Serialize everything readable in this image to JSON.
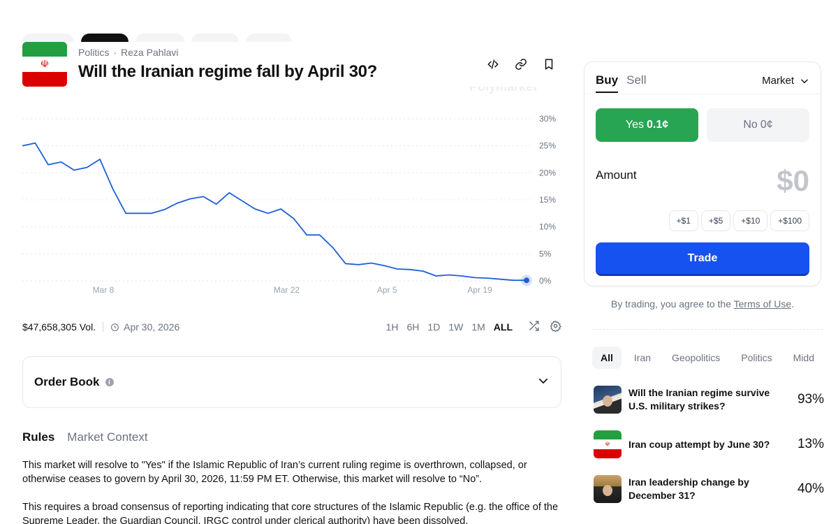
{
  "header": {
    "category": "Politics",
    "subcategory": "Reza Pahlavi",
    "title": "Will the Iranian regime fall by April 30?",
    "watermark": "Polymarket"
  },
  "chart_data": {
    "type": "line",
    "x": [
      "Mar 3",
      "Mar 4",
      "Mar 5",
      "Mar 6",
      "Mar 7",
      "Mar 8",
      "Mar 9",
      "Mar 10",
      "Mar 11",
      "Mar 12",
      "Mar 13",
      "Mar 14",
      "Mar 15",
      "Mar 16",
      "Mar 17",
      "Mar 18",
      "Mar 19",
      "Mar 20",
      "Mar 21",
      "Mar 22",
      "Mar 23",
      "Mar 24",
      "Mar 26",
      "Mar 28",
      "Mar 30",
      "Apr 1",
      "Apr 3",
      "Apr 5",
      "Apr 7",
      "Apr 9",
      "Apr 11",
      "Apr 13",
      "Apr 15",
      "Apr 17",
      "Apr 19",
      "Apr 21",
      "Apr 23",
      "Apr 25",
      "Apr 27",
      "Apr 29"
    ],
    "series": [
      {
        "values": [
          25,
          25.5,
          21.5,
          22,
          20.5,
          21,
          22.5,
          17,
          12.5,
          12.5,
          12.5,
          13.2,
          14.4,
          15.2,
          15.6,
          14.2,
          16.3,
          14.8,
          13.3,
          12.5,
          13.3,
          11.5,
          8.5,
          8.5,
          6.2,
          3.2,
          3,
          3.3,
          2.8,
          2.2,
          2.1,
          1.8,
          0.9,
          1.1,
          0.9,
          0.6,
          0.5,
          0.3,
          0.1,
          0.1
        ]
      }
    ],
    "yticks": [
      "30%",
      "25%",
      "20%",
      "15%",
      "10%",
      "5%",
      "0%"
    ],
    "xticks": [
      "Mar 8",
      "Mar 22",
      "Apr 5",
      "Apr 19"
    ],
    "ylim": [
      0,
      30
    ],
    "grid": true,
    "line_color": "#1f5fd6",
    "end_marker": "dot"
  },
  "stats": {
    "volume": "$47,658,305 Vol.",
    "end_date": "Apr 30, 2026",
    "ranges": [
      "1H",
      "6H",
      "1D",
      "1W",
      "1M",
      "ALL"
    ],
    "active_range": "ALL"
  },
  "orderbook": {
    "title": "Order Book"
  },
  "rules": {
    "tabs": [
      "Rules",
      "Market Context"
    ],
    "paragraph1": "This market will resolve to \"Yes\" if the Islamic Republic of Iran’s current ruling regime is overthrown, collapsed, or otherwise ceases to govern by April 30, 2026, 11:59 PM ET. Otherwise, this market will resolve to “No”.",
    "paragraph2": "This requires a broad consensus of reporting indicating that core structures of the Islamic Republic (e.g. the office of the Supreme Leader, the Guardian Council, IRGC control under clerical authority) have been dissolved."
  },
  "trade": {
    "tab_buy": "Buy",
    "tab_sell": "Sell",
    "order_type": "Market",
    "yes_label": "Yes",
    "yes_price": "0.1¢",
    "no_label": "No",
    "no_price": "0¢",
    "amount_label": "Amount",
    "amount_value": "$0",
    "quick_amounts": [
      "+$1",
      "+$5",
      "+$10",
      "+$100"
    ],
    "trade_button": "Trade",
    "terms_prefix": "By trading, you agree to the",
    "terms_link": "Terms of Use",
    "terms_suffix": "."
  },
  "related": {
    "tabs": [
      "All",
      "Iran",
      "Geopolitics",
      "Politics",
      "Midd"
    ],
    "items": [
      {
        "question": "Will the Iranian regime survive U.S. military strikes?",
        "percent": "93%"
      },
      {
        "question": "Iran coup attempt by June 30?",
        "percent": "13%"
      },
      {
        "question": "Iran leadership change by December 31?",
        "percent": "40%"
      }
    ]
  }
}
